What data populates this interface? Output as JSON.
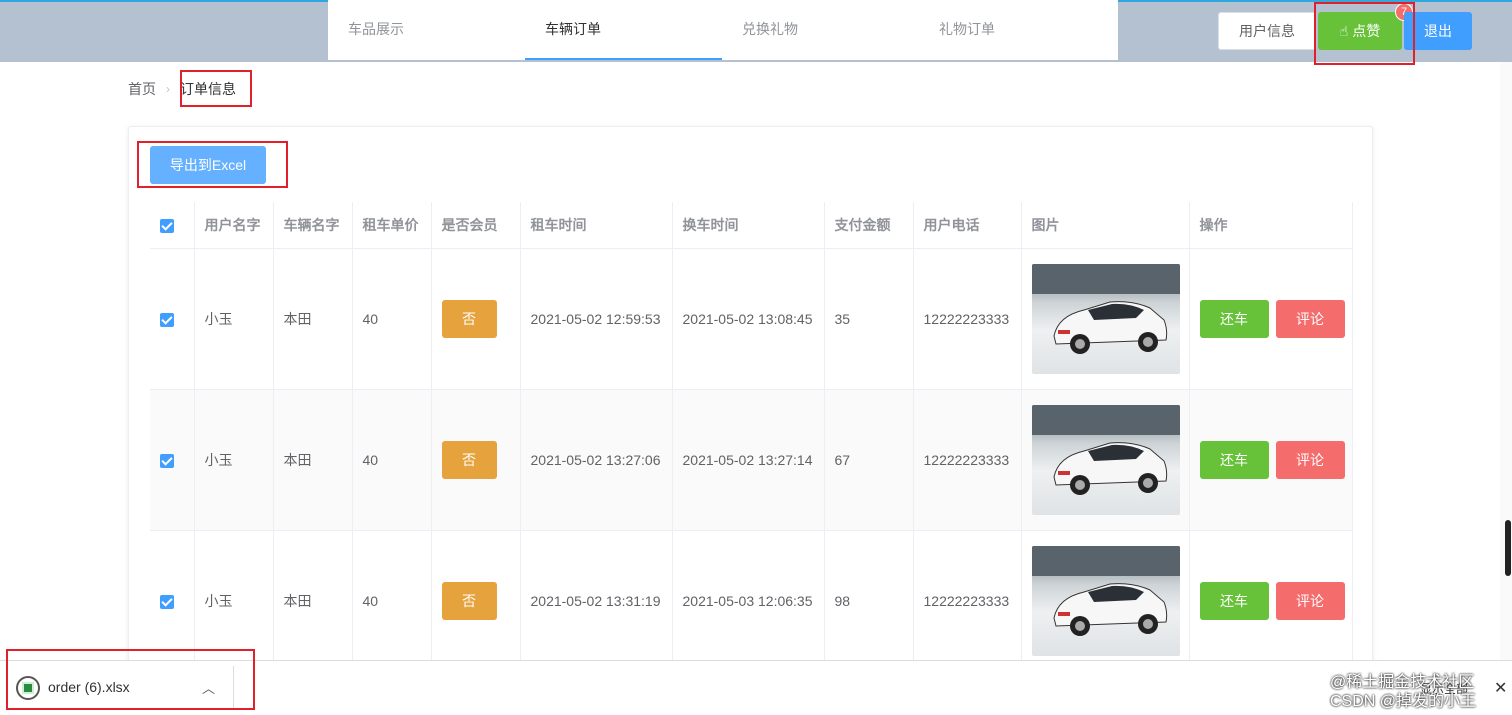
{
  "nav": {
    "tabs": [
      "车品展示",
      "车辆订单",
      "兑换礼物",
      "礼物订单"
    ],
    "active_tab": "车辆订单"
  },
  "header": {
    "user_info_label": "用户信息",
    "like_label": "点赞",
    "like_badge": "7",
    "logout_label": "退出"
  },
  "breadcrumb": {
    "home": "首页",
    "current": "订单信息"
  },
  "export_label": "导出到Excel",
  "table": {
    "headers": [
      "用户名字",
      "车辆名字",
      "租车单价",
      "是否会员",
      "租车时间",
      "换车时间",
      "支付金额",
      "用户电话",
      "图片",
      "操作"
    ],
    "rows": [
      {
        "user": "小玉",
        "car": "本田",
        "price": "40",
        "member": "否",
        "rent_time": "2021-05-02 12:59:53",
        "return_time": "2021-05-02 13:08:45",
        "amount": "35",
        "phone": "12222223333",
        "return_label": "还车",
        "comment_label": "评论"
      },
      {
        "user": "小玉",
        "car": "本田",
        "price": "40",
        "member": "否",
        "rent_time": "2021-05-02 13:27:06",
        "return_time": "2021-05-02 13:27:14",
        "amount": "67",
        "phone": "12222223333",
        "return_label": "还车",
        "comment_label": "评论"
      },
      {
        "user": "小玉",
        "car": "本田",
        "price": "40",
        "member": "否",
        "rent_time": "2021-05-02 13:31:19",
        "return_time": "2021-05-03 12:06:35",
        "amount": "98",
        "phone": "12222223333",
        "return_label": "还车",
        "comment_label": "评论"
      }
    ]
  },
  "download": {
    "file_name": "order (6).xlsx",
    "show_all": "显示全部"
  },
  "watermark": {
    "line1": "@稀土掘金技术社区",
    "line2": "CSDN @掉发的小王"
  },
  "colors": {
    "primary": "#409eff",
    "success": "#67c23a",
    "danger": "#f56c6c",
    "warning": "#e6a23c",
    "highlight_box": "#e0202a"
  }
}
